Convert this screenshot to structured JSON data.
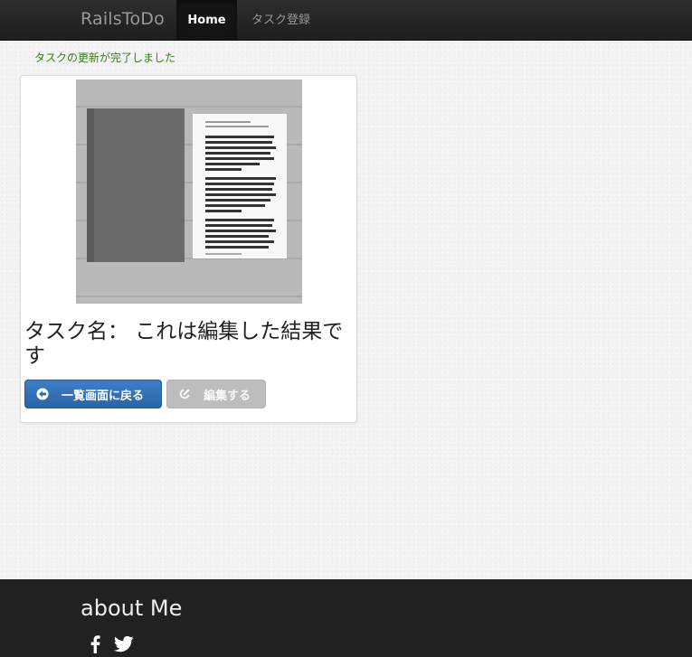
{
  "navbar": {
    "brand": "RailsToDo",
    "items": [
      {
        "label": "Home",
        "active": true
      },
      {
        "label": "タスク登録",
        "active": false
      }
    ]
  },
  "flash": {
    "message": "タスクの更新が完了しました",
    "color": "#3c7a1a"
  },
  "task": {
    "title": "タスク名： これは編集した結果です",
    "image": "book-and-document-photo"
  },
  "actions": {
    "back_label": "一覧画面に戻る",
    "back_icon": "circle-arrow-left-icon",
    "edit_label": "編集する",
    "edit_icon": "edit-icon",
    "primary_color": "#2f6eb5"
  },
  "footer": {
    "title": "about Me",
    "social": [
      "facebook-icon",
      "twitter-icon"
    ]
  }
}
